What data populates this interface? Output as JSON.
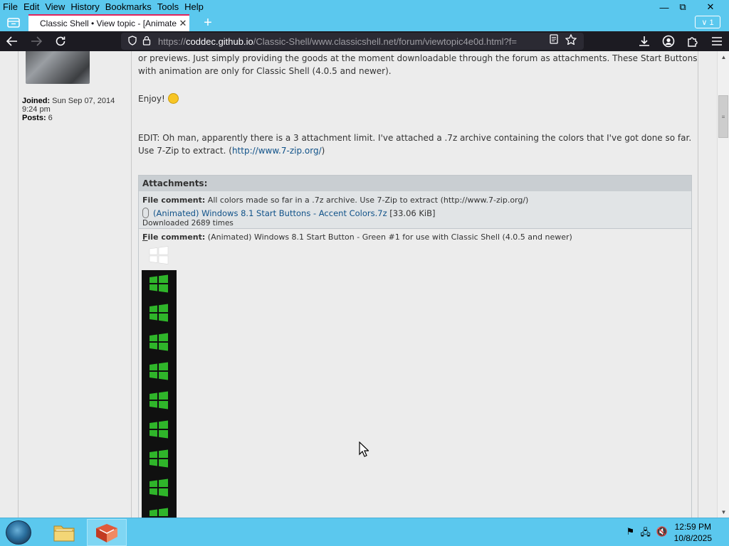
{
  "menu": {
    "file": "File",
    "edit": "Edit",
    "view": "View",
    "history": "History",
    "bookmarks": "Bookmarks",
    "tools": "Tools",
    "help": "Help"
  },
  "window": {
    "minimize": "—",
    "restore": "⧉",
    "close": "✕"
  },
  "tabs": {
    "active_title": "Classic Shell • View topic - [Animate",
    "close": "✕",
    "new_tab": "+",
    "overflow": "∨ 1"
  },
  "nav": {
    "url_prefix": "https://",
    "url_host": "coddec.github.io",
    "url_path": "/Classic-Shell/www.classicshell.net/forum/viewtopic4e0d.html?f="
  },
  "profile": {
    "joined_label": "Joined:",
    "joined_value": " Sun Sep 07, 2014",
    "joined_time": "9:24 pm",
    "posts_label": "Posts:",
    "posts_value": " 6"
  },
  "post": {
    "line1": "or previews. Just simply providing the goods at the moment downloadable through the forum as attachments. These Start Buttons",
    "line2": "with animation are only for Classic Shell (4.0.5 and newer).",
    "enjoy": "Enjoy!",
    "edit_line1": "EDIT: Oh man, apparently there is a 3 attachment limit. I've attached a .7z archive containing the colors that I've got done so far.",
    "edit_line2_prefix": "Use 7-Zip to extract. (",
    "edit_link": "http://www.7-zip.org/",
    "edit_line2_suffix": ")"
  },
  "attachments": {
    "header": "Attachments:",
    "a1": {
      "comment_label": "File comment:",
      "comment": " All colors made so far in a .7z archive. Use 7-Zip to extract (http://www.7-zip.org/)",
      "file_link": "(Animated) Windows 8.1 Start Buttons - Accent Colors.7z",
      "size": " [33.06 KiB]",
      "downloads": "Downloaded 2689 times"
    },
    "a2": {
      "comment_label_u": "F",
      "comment_label_rest": "ile comment:",
      "comment": " (Animated) Windows 8.1 Start Button - Green #1 for use with Classic Shell (4.0.5 and newer)"
    }
  },
  "taskbar": {
    "time": "12:59 PM",
    "date": "10/8/2025"
  },
  "colors": {
    "link": "#105289",
    "tab_accent": "#e1245c",
    "taskbar": "#5bc8ee",
    "win_green": "#2fb52a"
  }
}
